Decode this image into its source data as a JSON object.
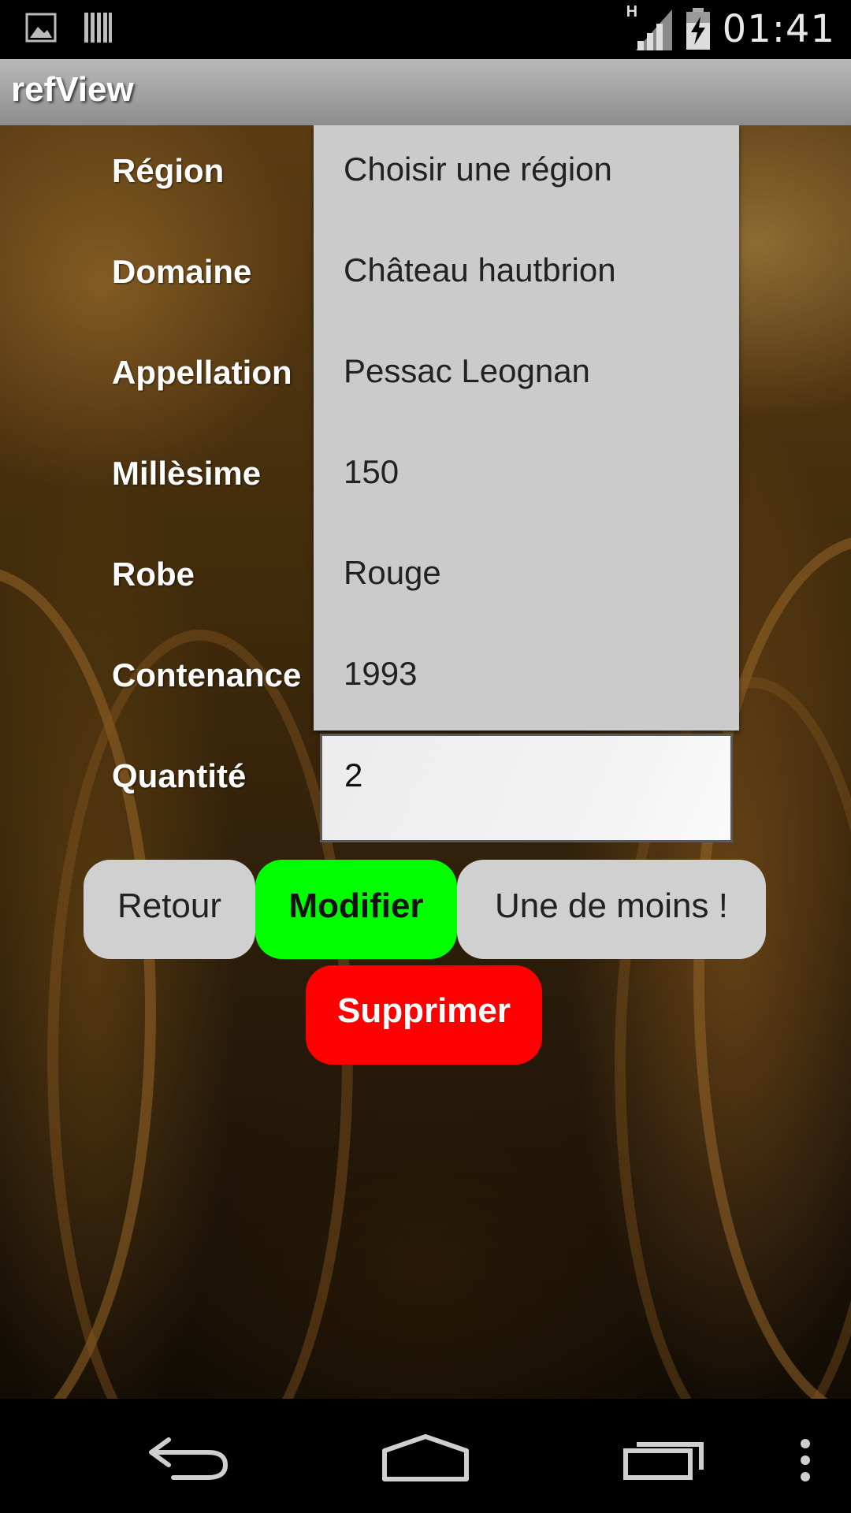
{
  "status_bar": {
    "time": "01:41",
    "network_label": "H",
    "icons": [
      "image-icon",
      "barcode-icon",
      "signal-icon",
      "battery-charging-icon"
    ]
  },
  "action_bar": {
    "title": "refView"
  },
  "form": {
    "labels": {
      "region": "Région",
      "domaine": "Domaine",
      "appellation": "Appellation",
      "millesime": "Millèsime",
      "robe": "Robe",
      "contenance": "Contenance",
      "quantite": "Quantité"
    },
    "dropdown_items": [
      "Choisir une région",
      "Château hautbrion",
      "Pessac Leognan",
      "150",
      "Rouge",
      "1993"
    ],
    "quantity_value": "2"
  },
  "buttons": {
    "retour": "Retour",
    "modifier": "Modifier",
    "une_de_moins": "Une de moins !",
    "supprimer": "Supprimer"
  },
  "colors": {
    "modifier_bg": "#00ff00",
    "supprimer_bg": "#ff0000",
    "neutral_button_bg": "#d0d0d0",
    "dropdown_bg": "#cbcbcb"
  },
  "nav_bar": {
    "icons": [
      "back-icon",
      "home-icon",
      "recent-apps-icon",
      "overflow-menu-icon"
    ]
  }
}
